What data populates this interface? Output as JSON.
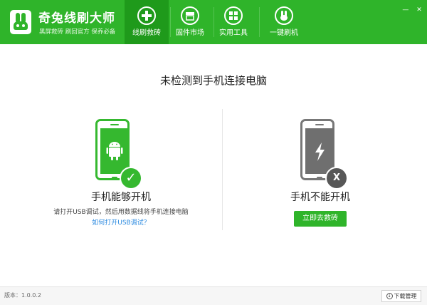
{
  "header": {
    "title": "奇兔线刷大师",
    "slogan": "黑屏救砖 刷回官方 保养必备",
    "tabs": [
      {
        "label": "线刷救砖",
        "icon": "plus-cross-icon",
        "active": true
      },
      {
        "label": "固件市场",
        "icon": "store-icon",
        "active": false
      },
      {
        "label": "实用工具",
        "icon": "grid-icon",
        "active": false
      },
      {
        "label": "一键刷机",
        "icon": "rabbit-icon",
        "active": false
      }
    ],
    "window_controls": {
      "minimize": "—",
      "close": "✕"
    }
  },
  "main": {
    "title": "未检测到手机连接电脑",
    "left_case": {
      "title": "手机能够开机",
      "description": "请打开USB调试，然后用数据线将手机连接电脑",
      "link": "如何打开USB调试？",
      "badge": "✓"
    },
    "right_case": {
      "title": "手机不能开机",
      "button": "立即去救砖",
      "badge": "X"
    }
  },
  "footer": {
    "version": "版本：1.0.0.2",
    "download_button": "下载管理",
    "download_icon": "↓"
  },
  "colors": {
    "brand_green": "#2fb42a",
    "active_tab": "#1f9a1b",
    "link_blue": "#2b8ae0",
    "phone_gray": "#6f6f6f"
  }
}
